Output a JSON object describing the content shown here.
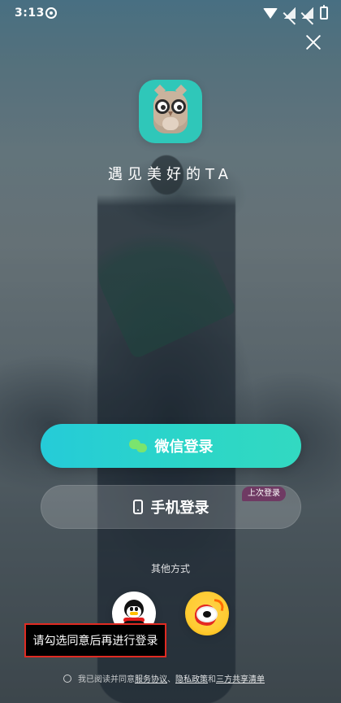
{
  "status_bar": {
    "time": "3:13"
  },
  "app": {
    "tagline": "遇见美好的TA"
  },
  "login": {
    "wechat_label": "微信登录",
    "phone_label": "手机登录",
    "last_login_badge": "上次登录",
    "other_methods": "其他方式"
  },
  "toast": {
    "message": "请勾选同意后再进行登录"
  },
  "agreement": {
    "prefix": "我已阅读并同意",
    "service": "服务协议",
    "sep1": "、",
    "privacy": "隐私政策",
    "and": "和",
    "third_party": "三方共享清单"
  },
  "colors": {
    "accent_start": "#25cbd8",
    "accent_end": "#32d9c1",
    "toast_border": "#e02b22",
    "badge": "#6f3a63"
  },
  "icons": {
    "close": "close-icon",
    "wechat": "wechat-icon",
    "phone": "phone-icon",
    "qq": "qq-icon",
    "weibo": "weibo-icon",
    "app_logo": "owl-logo-icon"
  }
}
